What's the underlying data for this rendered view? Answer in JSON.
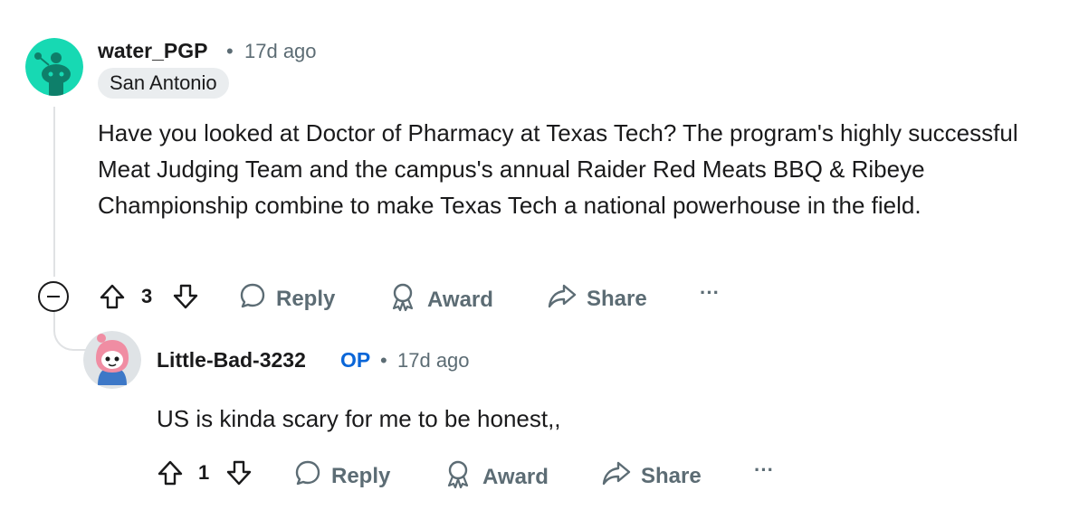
{
  "comment1": {
    "username": "water_PGP",
    "separator": "•",
    "time": "17d ago",
    "flair": "San Antonio",
    "body": "Have you looked at Doctor of Pharmacy at Texas Tech? The program's highly successful Meat Judging Team and the campus's annual Raider Red Meats BBQ & Ribeye Championship combine to make Texas Tech a national powerhouse in the field.",
    "score": "3",
    "reply_label": "Reply",
    "award_label": "Award",
    "share_label": "Share",
    "more_label": "···"
  },
  "comment2": {
    "username": "Little-Bad-3232",
    "op_badge": "OP",
    "separator": "•",
    "time": "17d ago",
    "body": "US is kinda scary for me to be honest,,",
    "score": "1",
    "reply_label": "Reply",
    "award_label": "Award",
    "share_label": "Share",
    "more_label": "···"
  },
  "colors": {
    "avatar1_bg": "#17d9b3",
    "op_badge": "#0a66d8",
    "meta_text": "#5c6c74",
    "thread_line": "#e0e2e4"
  }
}
